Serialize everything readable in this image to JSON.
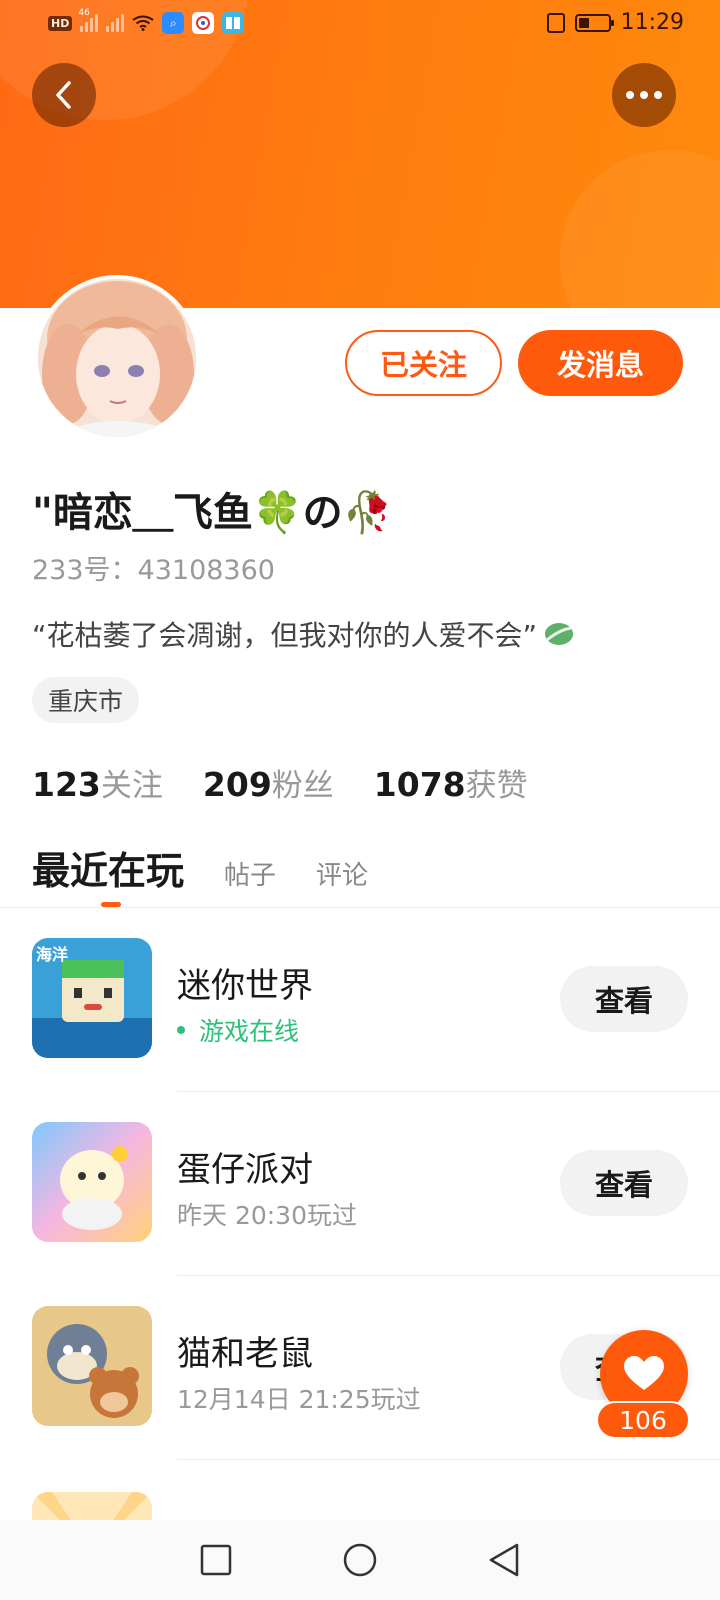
{
  "status_bar": {
    "hd_label": "HD",
    "network_label": "46",
    "time": "11:29"
  },
  "profile": {
    "username": "\"暗恋＿飞鱼🍀の🥀",
    "id_line": "233号：43108360",
    "signature": "“花枯萎了会凋谢，但我对你的人爱不会”",
    "location": "重庆市",
    "follow_label": "已关注",
    "message_label": "发消息"
  },
  "stats": [
    {
      "num": "123",
      "label": "关注"
    },
    {
      "num": "209",
      "label": "粉丝"
    },
    {
      "num": "1078",
      "label": "获赞"
    }
  ],
  "tabs": [
    {
      "label": "最近在玩",
      "active": true
    },
    {
      "label": "帖子",
      "active": false
    },
    {
      "label": "评论",
      "active": false
    }
  ],
  "games": [
    {
      "name": "迷你世界",
      "status": "游戏在线",
      "online": true,
      "button": "查看",
      "icon": "mini-world-icon",
      "icon_text": "海洋"
    },
    {
      "name": "蛋仔派对",
      "status": "昨天 20:30玩过",
      "online": false,
      "button": "查看",
      "icon": "eggy-party-icon"
    },
    {
      "name": "猫和老鼠",
      "status": "12月14日 21:25玩过",
      "online": false,
      "button": "查看",
      "icon": "tom-and-jerry-icon"
    }
  ],
  "like": {
    "count": "106"
  },
  "colors": {
    "accent": "#ff5a0c",
    "online": "#2cc27a"
  }
}
